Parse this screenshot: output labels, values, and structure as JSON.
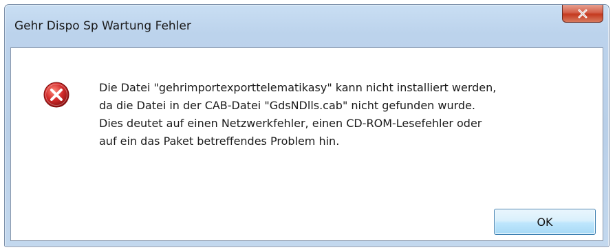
{
  "window": {
    "title": "Gehr Dispo Sp Wartung Fehler",
    "close_icon": "close-icon"
  },
  "dialog": {
    "icon": "error-icon",
    "message_lines": [
      "Die Datei \"gehrimportexporttelematikasy\" kann nicht installiert werden,",
      "da die Datei in der CAB-Datei \"GdsNDlls.cab\" nicht gefunden wurde.",
      "Dies deutet auf einen Netzwerkfehler, einen CD-ROM-Lesefehler oder",
      "auf ein das Paket betreffendes Problem hin."
    ],
    "ok_label": "OK"
  },
  "colors": {
    "title_bar": "#bcd3ec",
    "close_button": "#c4391f",
    "error_red": "#d22b2b",
    "ok_border": "#3c7fb1"
  }
}
